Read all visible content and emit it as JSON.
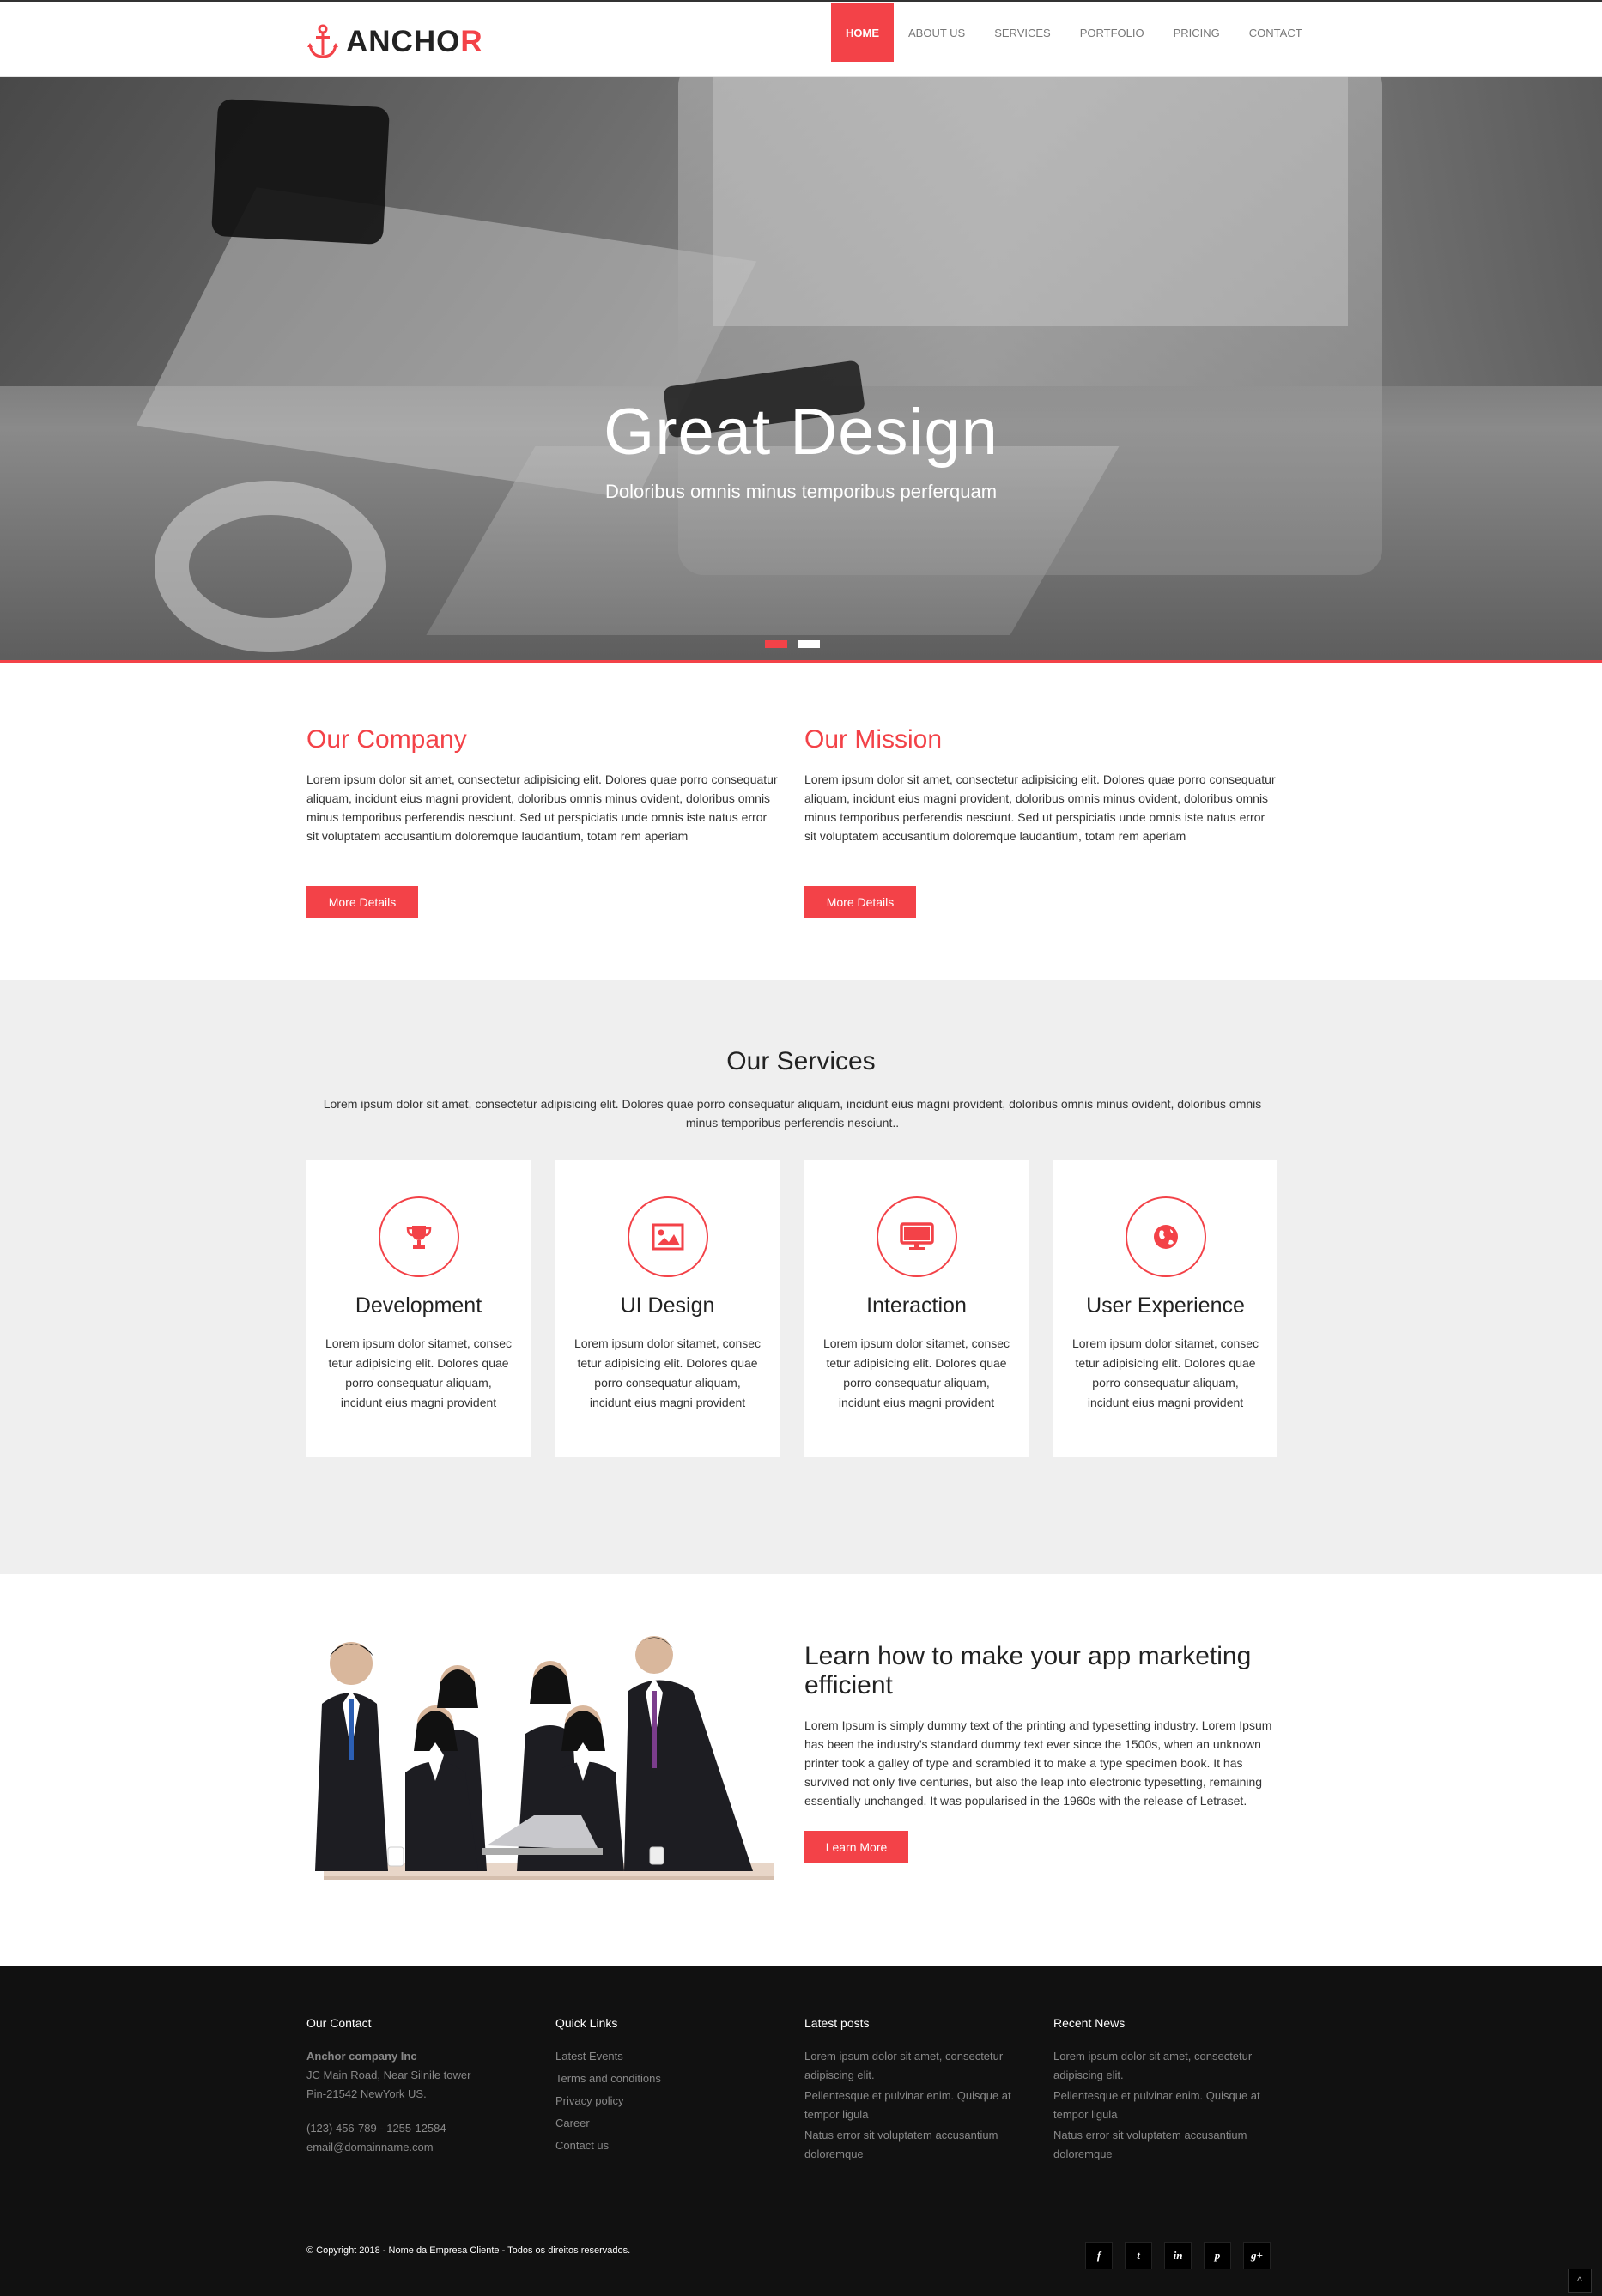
{
  "brand": {
    "name_main": "ANCHO",
    "name_last": "R",
    "accent": "#f34248"
  },
  "nav": {
    "items": [
      "HOME",
      "ABOUT US",
      "SERVICES",
      "PORTFOLIO",
      "PRICING",
      "CONTACT"
    ],
    "active": "HOME"
  },
  "hero": {
    "title": "Great Design",
    "subtitle": "Doloribus omnis minus temporibus perferquam",
    "slide_count": 2,
    "active_slide": 1
  },
  "company": {
    "title": "Our Company",
    "text": "Lorem ipsum dolor sit amet, consectetur adipisicing elit. Dolores quae porro consequatur aliquam, incidunt eius magni provident, doloribus omnis minus ovident, doloribus omnis minus temporibus perferendis nesciunt. Sed ut perspiciatis unde omnis iste natus error sit voluptatem accusantium doloremque laudantium, totam rem aperiam",
    "button": "More Details"
  },
  "mission": {
    "title": "Our Mission",
    "text": "Lorem ipsum dolor sit amet, consectetur adipisicing elit. Dolores quae porro consequatur aliquam, incidunt eius magni provident, doloribus omnis minus ovident, doloribus omnis minus temporibus perferendis nesciunt. Sed ut perspiciatis unde omnis iste natus error sit voluptatem accusantium doloremque laudantium, totam rem aperiam",
    "button": "More Details"
  },
  "services": {
    "title": "Our Services",
    "description": "Lorem ipsum dolor sit amet, consectetur adipisicing elit. Dolores quae porro consequatur aliquam, incidunt eius magni provident, doloribus omnis minus ovident, doloribus omnis minus temporibus perferendis nesciunt..",
    "cards": [
      {
        "icon": "trophy-icon",
        "title": "Development",
        "text": "Lorem ipsum dolor sitamet, consec tetur adipisicing elit. Dolores quae porro consequatur aliquam, incidunt eius magni provident"
      },
      {
        "icon": "image-icon",
        "title": "UI Design",
        "text": "Lorem ipsum dolor sitamet, consec tetur adipisicing elit. Dolores quae porro consequatur aliquam, incidunt eius magni provident"
      },
      {
        "icon": "desktop-icon",
        "title": "Interaction",
        "text": "Lorem ipsum dolor sitamet, consec tetur adipisicing elit. Dolores quae porro consequatur aliquam, incidunt eius magni provident"
      },
      {
        "icon": "globe-icon",
        "title": "User Experience",
        "text": "Lorem ipsum dolor sitamet, consec tetur adipisicing elit. Dolores quae porro consequatur aliquam, incidunt eius magni provident"
      }
    ]
  },
  "learn": {
    "title": "Learn how to make your app marketing efficient",
    "text": "Lorem Ipsum is simply dummy text of the printing and typesetting industry. Lorem Ipsum has been the industry's standard dummy text ever since the 1500s, when an unknown printer took a galley of type and scrambled it to make a type specimen book. It has survived not only five centuries, but also the leap into electronic typesetting, remaining essentially unchanged. It was popularised in the 1960s with the release of Letraset.",
    "button": "Learn More"
  },
  "footer": {
    "contact": {
      "title": "Our Contact",
      "company": "Anchor company Inc",
      "address1": "JC Main Road, Near Silnile tower",
      "address2": "Pin-21542 NewYork US.",
      "phone": "(123) 456-789 - 1255-12584",
      "email": "email@domainname.com"
    },
    "quick_links": {
      "title": "Quick Links",
      "items": [
        "Latest Events",
        "Terms and conditions",
        "Privacy policy",
        "Career",
        "Contact us"
      ]
    },
    "latest_posts": {
      "title": "Latest posts",
      "items": [
        "Lorem ipsum dolor sit amet, consectetur adipiscing elit.",
        "Pellentesque et pulvinar enim. Quisque at tempor ligula",
        "Natus error sit voluptatem accusantium doloremque"
      ]
    },
    "recent_news": {
      "title": "Recent News",
      "items": [
        "Lorem ipsum dolor sit amet, consectetur adipiscing elit.",
        "Pellentesque et pulvinar enim. Quisque at tempor ligula",
        "Natus error sit voluptatem accusantium doloremque"
      ]
    },
    "copyright": "© Copyright 2018 - Nome da Empresa Cliente - Todos os direitos reservados.",
    "socials": [
      {
        "icon": "facebook-icon",
        "glyph": "f"
      },
      {
        "icon": "twitter-icon",
        "glyph": "t"
      },
      {
        "icon": "linkedin-icon",
        "glyph": "in"
      },
      {
        "icon": "pinterest-icon",
        "glyph": "p"
      },
      {
        "icon": "google-plus-icon",
        "glyph": "g+"
      }
    ],
    "to_top_glyph": "^"
  }
}
